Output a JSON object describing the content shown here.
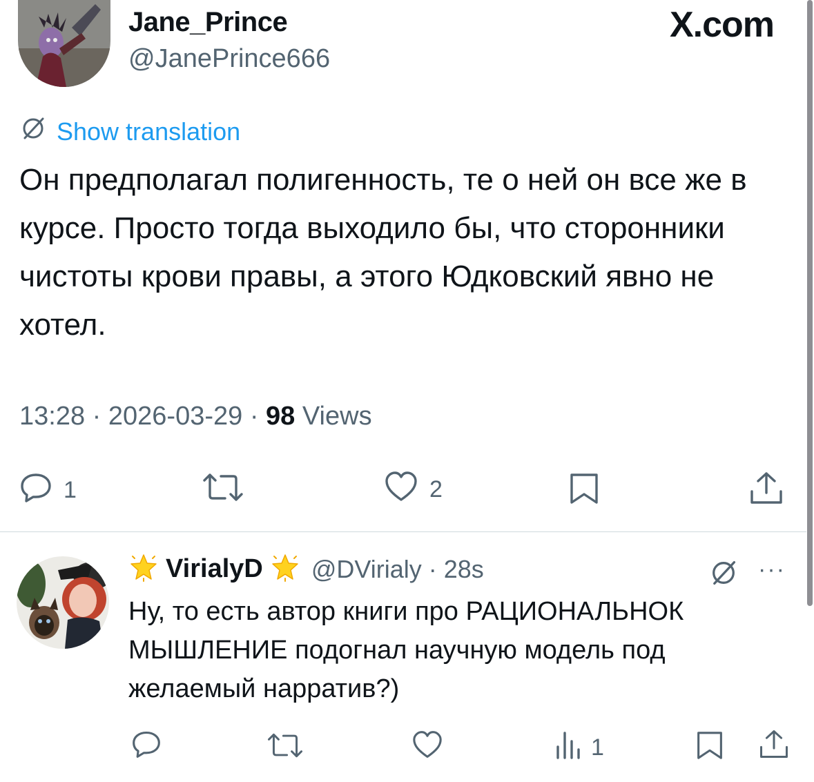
{
  "site_label": "X.com",
  "tweet": {
    "author_name": "Jane_Prince",
    "author_handle": "@JanePrince666",
    "translate_label": "Show translation",
    "text": "Он предполагал полигенность, те о ней он все же в курсе. Просто тогда выходило бы, что сторонники чистоты крови правы, а этого Юдковский явно не хотел.",
    "time": "13:28",
    "date": "2026-03-29",
    "separator": "·",
    "views_count": "98",
    "views_label": "Views",
    "reply_count": "1",
    "like_count": "2"
  },
  "reply": {
    "author_name": "VirialyD",
    "author_handle": "@DVirialy",
    "age": "28s",
    "separator": "·",
    "text": "Ну, то есть автор книги про РАЦИОНАЛЬНОК МЫШЛЕНИЕ подогнал научную модель под желаемый нарратив?)",
    "views_count": "1",
    "more": "···"
  },
  "icons": {
    "translate": "translate-icon",
    "reply": "reply-icon",
    "retweet": "retweet-icon",
    "like": "heart-icon",
    "bookmark": "bookmark-icon",
    "share": "share-icon",
    "views": "views-icon",
    "star": "star-emoji-icon",
    "grok": "grok-icon",
    "more": "more-icon"
  },
  "colors": {
    "text": "#0f1419",
    "secondary": "#536471",
    "link": "#1d9bf0",
    "divider": "#cfd9de"
  }
}
